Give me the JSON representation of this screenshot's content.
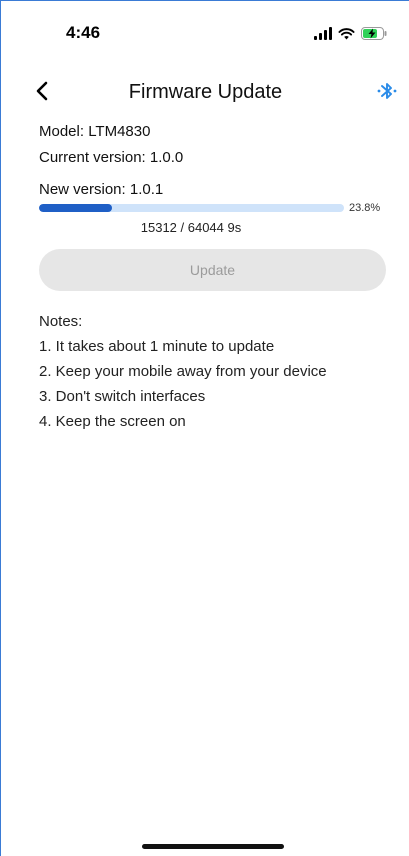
{
  "status_bar": {
    "time": "4:46",
    "battery_color": "#30d158"
  },
  "nav": {
    "title": "Firmware Update",
    "back_icon": "chevron-left-icon",
    "bluetooth_icon": "bluetooth-icon",
    "bluetooth_color": "#2a8be8"
  },
  "device": {
    "model": "Model: LTM4830",
    "current_version": "Current version: 1.0.0",
    "new_version": "New version: 1.0.1"
  },
  "progress": {
    "percent_label": "23.8%",
    "fraction": 0.238,
    "count_label": "15312 / 64044  9s",
    "fill_color": "#1f5fc6",
    "track_color": "#cfe3fa"
  },
  "update_button": {
    "label": "Update",
    "enabled": false
  },
  "notes": {
    "title": "Notes:",
    "items": [
      "1. It takes about 1 minute to update",
      "2. Keep your mobile away from your device",
      "3. Don't switch interfaces",
      "4. Keep the screen on"
    ]
  }
}
